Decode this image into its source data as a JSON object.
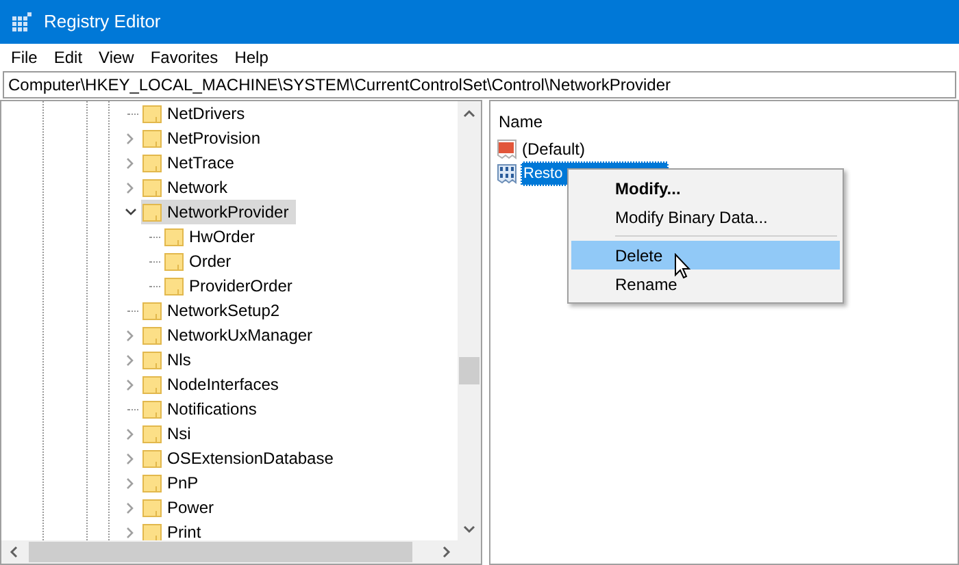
{
  "window": {
    "title": "Registry Editor"
  },
  "menu_bar": [
    "File",
    "Edit",
    "View",
    "Favorites",
    "Help"
  ],
  "address_bar": {
    "value": "Computer\\HKEY_LOCAL_MACHINE\\SYSTEM\\CurrentControlSet\\Control\\NetworkProvider"
  },
  "tree": [
    {
      "label": "NetDrivers",
      "expandable": false,
      "selected": false
    },
    {
      "label": "NetProvision",
      "expandable": true,
      "expanded": false,
      "selected": false
    },
    {
      "label": "NetTrace",
      "expandable": true,
      "expanded": false,
      "selected": false
    },
    {
      "label": "Network",
      "expandable": true,
      "expanded": false,
      "selected": false
    },
    {
      "label": "NetworkProvider",
      "expandable": true,
      "expanded": true,
      "selected": true,
      "children": [
        {
          "label": "HwOrder",
          "expandable": false,
          "selected": false
        },
        {
          "label": "Order",
          "expandable": false,
          "selected": false
        },
        {
          "label": "ProviderOrder",
          "expandable": false,
          "selected": false
        }
      ]
    },
    {
      "label": "NetworkSetup2",
      "expandable": false,
      "selected": false
    },
    {
      "label": "NetworkUxManager",
      "expandable": true,
      "expanded": false,
      "selected": false
    },
    {
      "label": "Nls",
      "expandable": true,
      "expanded": false,
      "selected": false
    },
    {
      "label": "NodeInterfaces",
      "expandable": true,
      "expanded": false,
      "selected": false
    },
    {
      "label": "Notifications",
      "expandable": false,
      "selected": false
    },
    {
      "label": "Nsi",
      "expandable": true,
      "expanded": false,
      "selected": false
    },
    {
      "label": "OSExtensionDatabase",
      "expandable": true,
      "expanded": false,
      "selected": false
    },
    {
      "label": "PnP",
      "expandable": true,
      "expanded": false,
      "selected": false
    },
    {
      "label": "Power",
      "expandable": true,
      "expanded": false,
      "selected": false
    },
    {
      "label": "Print",
      "expandable": true,
      "expanded": false,
      "selected": false
    }
  ],
  "values_list": {
    "columns": [
      "Name"
    ],
    "rows": [
      {
        "name": "(Default)",
        "kind": "string",
        "selected": false
      },
      {
        "name": "Resto",
        "kind": "binary",
        "selected": true
      }
    ]
  },
  "context_menu": [
    {
      "kind": "item",
      "label": "Modify...",
      "default": true,
      "selected": false
    },
    {
      "kind": "item",
      "label": "Modify Binary Data...",
      "default": false,
      "selected": false
    },
    {
      "kind": "separator"
    },
    {
      "kind": "item",
      "label": "Delete",
      "default": false,
      "selected": true
    },
    {
      "kind": "item",
      "label": "Rename",
      "default": false,
      "selected": false
    }
  ]
}
